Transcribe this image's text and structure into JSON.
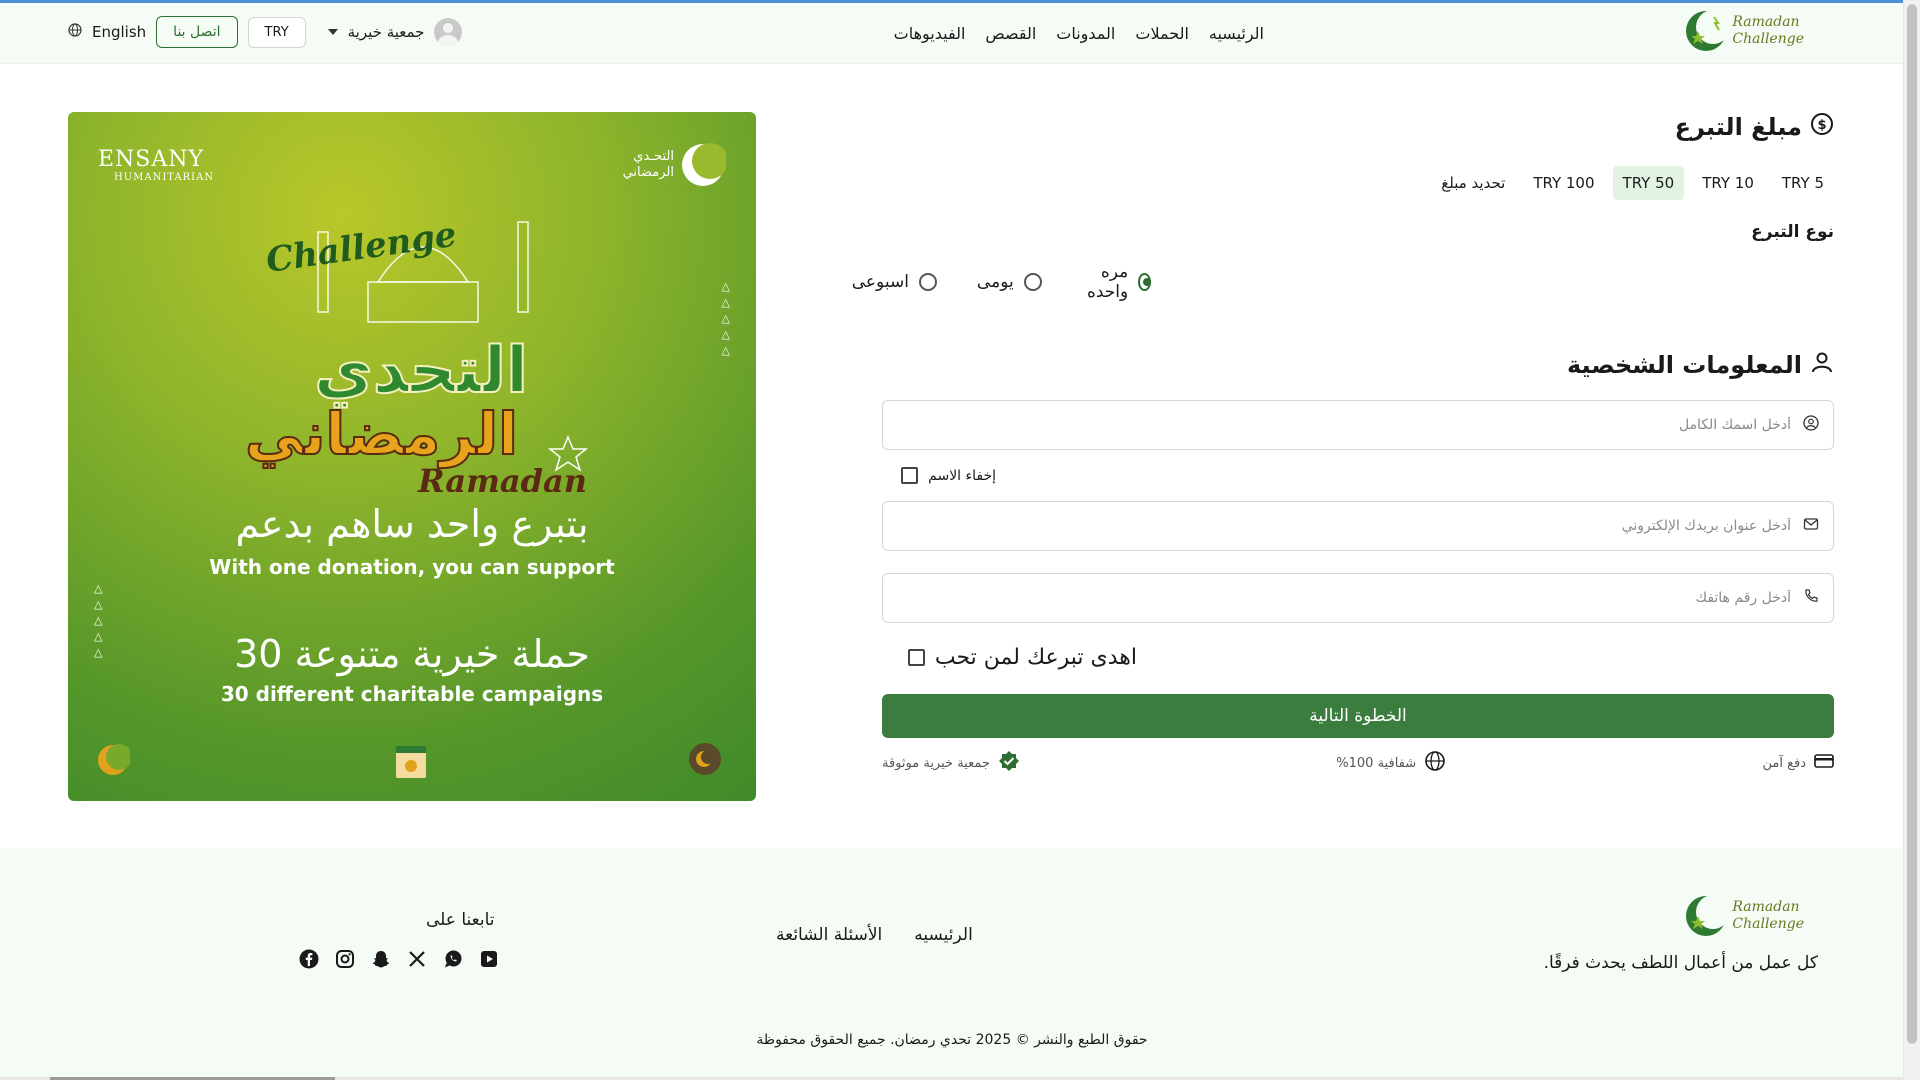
{
  "header": {
    "brand": {
      "line1": "Ramadan",
      "line2": "Challenge"
    },
    "nav": [
      "الرئيسيه",
      "الحملات",
      "المدونات",
      "القصص",
      "الفيديوهات"
    ],
    "charity_label": "جمعية خيرية",
    "currency": "TRY",
    "contact_label": "اتصل بنا",
    "language": "English"
  },
  "banner": {
    "org_name": "ENSANY",
    "org_sub": "HUMANITARIAN",
    "campaign_logo": {
      "line1": "التحـدي",
      "line2": "الرمضاني"
    },
    "headline_ar": "التحدي",
    "headline_ar2": "الرمضاني",
    "challenge_word": "Challenge",
    "ramadan_word": "Ramadan",
    "support_ar": "بتبرع واحد ساهم بدعم",
    "support_en": "With one donation, you can support",
    "campaigns_ar": "30 حملة خيرية متنوعة",
    "campaigns_en": "30 different charitable campaigns"
  },
  "donation": {
    "title": "مبلغ التبرع",
    "amounts": [
      "5 TRY",
      "10 TRY",
      "50 TRY",
      "100 TRY",
      "تحديد مبلغ"
    ],
    "selected_amount": "50 TRY",
    "type_label": "نوع التبرع",
    "types": [
      "مره واحده",
      "يومى",
      "اسبوعى"
    ],
    "selected_type": "مره واحده"
  },
  "personal": {
    "title": "المعلومات الشخصية",
    "name_placeholder": "أدخل اسمك الكامل",
    "hide_name_label": "إخفاء الاسم",
    "email_placeholder": "أدخل عنوان بريدك الإلكتروني",
    "phone_placeholder": "أدخل رقم هاتفك",
    "gift_label": "اهدى تبرعك لمن تحب",
    "next_label": "الخطوة التالية"
  },
  "trust": {
    "secure": "دفع آمن",
    "transparency": "شفافية 100%",
    "trusted": "جمعية خيرية موثوقة"
  },
  "footer": {
    "brand": {
      "line1": "Ramadan",
      "line2": "Challenge"
    },
    "tagline": "كل عمل من أعمال اللطف يحدث فرقًا.",
    "links": [
      "الرئيسيه",
      "الأسئلة الشائعة"
    ],
    "follow_label": "تابعنا على",
    "socials": [
      "youtube-icon",
      "whatsapp-icon",
      "x-icon",
      "snapchat-icon",
      "instagram-icon",
      "facebook-icon"
    ],
    "copyright": "حقوق الطبع والنشر © 2025 تحدي رمضان. جميع الحقوق محفوظة"
  },
  "colors": {
    "primary": "#3b7d3f",
    "accent_bg": "#e3f3e3",
    "header_bg": "#f5fbf5"
  }
}
